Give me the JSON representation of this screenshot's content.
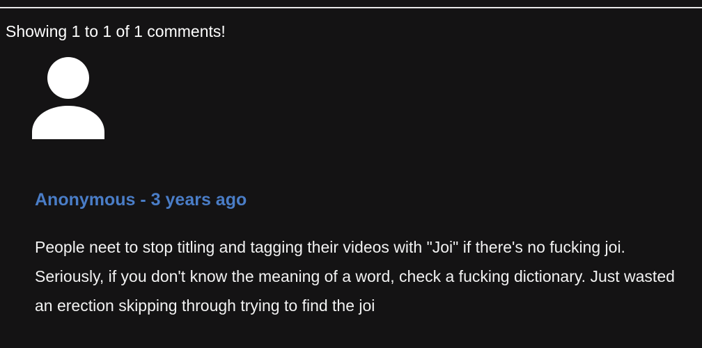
{
  "comments": {
    "summary": "Showing 1 to 1 of 1 comments!",
    "items": [
      {
        "avatar_icon": "user-avatar-icon",
        "author": "Anonymous",
        "separator": "-",
        "age": "3 years ago",
        "meta_line": "Anonymous - 3 years ago",
        "text": "People neet to stop titling and tagging their videos with \"Joi\" if there's no fucking joi. Seriously, if you don't know the meaning of a word, check a fucking dictionary. Just wasted an erection skipping through trying to find the joi"
      }
    ]
  },
  "colors": {
    "background": "#141314",
    "author_link": "#4a7dc7",
    "text": "#f2f2f2",
    "divider": "#e8e8e8"
  }
}
